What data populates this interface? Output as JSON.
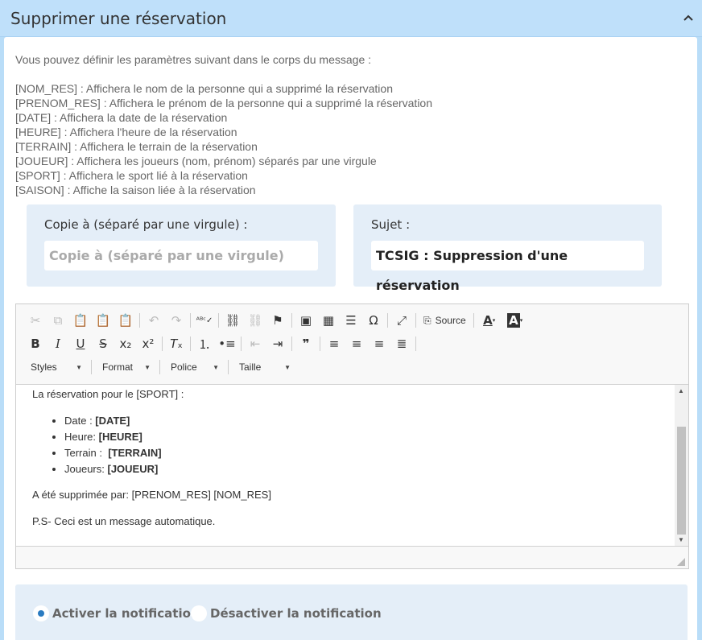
{
  "header": {
    "title": "Supprimer une réservation",
    "collapse_icon": "chevron-up-icon"
  },
  "intro": "Vous pouvez définir les paramètres suivant dans le corps du message :",
  "params": [
    "[NOM_RES] : Affichera le nom de la personne qui a supprimé la réservation",
    "[PRENOM_RES] : Affichera le prénom de la personne qui a supprimé la réservation",
    "[DATE] : Affichera la date de la réservation",
    "[HEURE] : Affichera l'heure de la réservation",
    "[TERRAIN] : Affichera le terrain de la réservation",
    "[JOUEUR] : Affichera les joueurs (nom, prénom) séparés par une virgule",
    "[SPORT] : Affichera le sport lié à la réservation",
    "[SAISON] : Affiche la saison liée à la réservation"
  ],
  "cc": {
    "label": "Copie à (séparé par une virgule) :",
    "placeholder": "Copie à (séparé par une virgule)",
    "value": ""
  },
  "subject": {
    "label": "Sujet :",
    "value": "TCSIG : Suppression d'une réservation"
  },
  "editor": {
    "toolbar": {
      "source_label": "Source",
      "combos": {
        "styles": "Styles",
        "format": "Format",
        "font": "Police",
        "size": "Taille"
      }
    },
    "content": {
      "intro": "La réservation pour le [SPORT] :",
      "items": [
        {
          "label": "Date : ",
          "value": "[DATE]"
        },
        {
          "label": "Heure: ",
          "value": "[HEURE]"
        },
        {
          "label": "Terrain :  ",
          "value": "[TERRAIN]"
        },
        {
          "label": "Joueurs: ",
          "value": "[JOUEUR]"
        }
      ],
      "deleted_by": "A été supprimée par: [PRENOM_RES] [NOM_RES]",
      "ps": "P.S- Ceci est un message automatique."
    }
  },
  "notification": {
    "options": [
      {
        "label": "Activer la notification",
        "selected": true
      },
      {
        "label": "Désactiver la notification",
        "selected": false
      }
    ]
  },
  "colors": {
    "accent": "#2a7bc1",
    "header_bg": "#bfe0fa",
    "box_bg": "#e4eef8"
  }
}
